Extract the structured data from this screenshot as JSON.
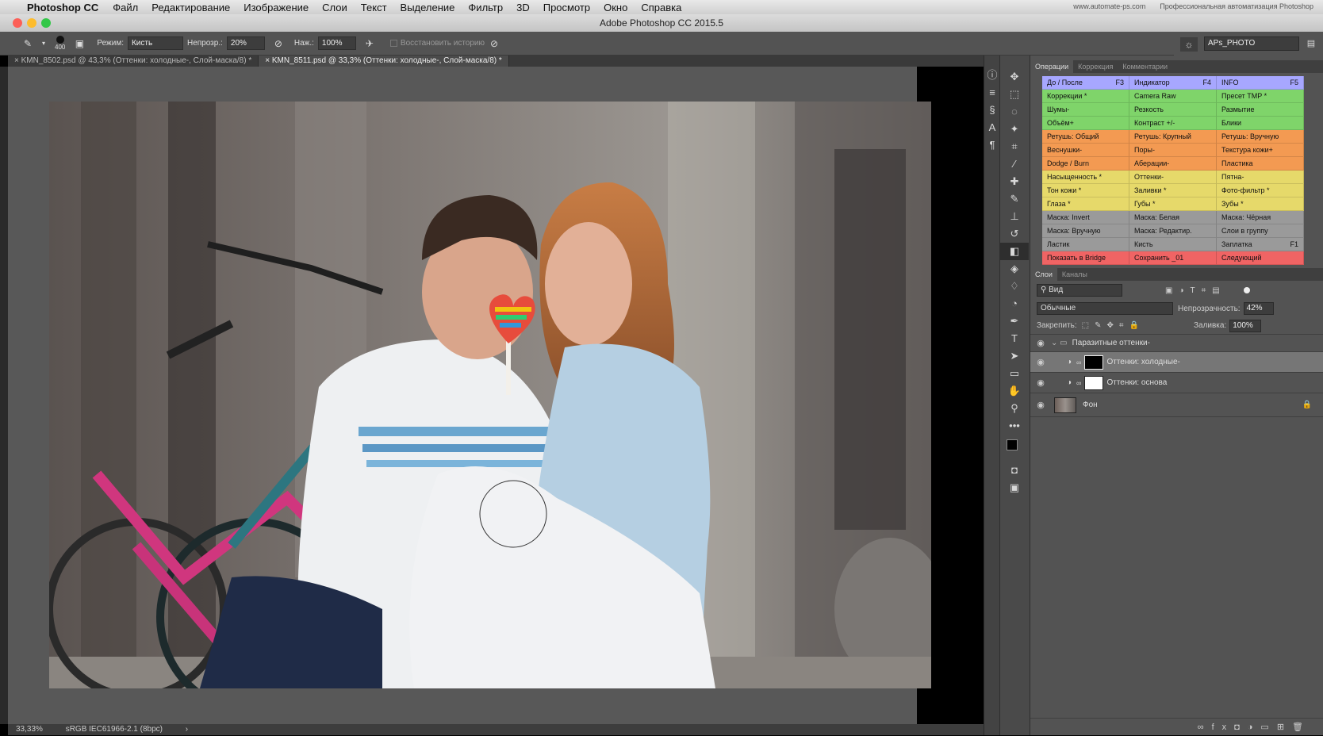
{
  "menubar": {
    "app": "Photoshop CC",
    "items": [
      "Файл",
      "Редактирование",
      "Изображение",
      "Слои",
      "Текст",
      "Выделение",
      "Фильтр",
      "3D",
      "Просмотр",
      "Окно",
      "Справка"
    ],
    "right_url": "www.automate-ps.com",
    "right_text": "Профессиональная автоматизация Photoshop"
  },
  "titlebar": {
    "title": "Adobe Photoshop CC 2015.5"
  },
  "options": {
    "brush_size": "400",
    "mode_label": "Режим:",
    "mode_value": "Кисть",
    "opacity_label": "Непрозр.:",
    "opacity_value": "20%",
    "flow_label": "Наж.:",
    "flow_value": "100%",
    "history_label": "Восстановить историю"
  },
  "workspace": {
    "name": "APs_PHOTO"
  },
  "doc_tabs": [
    {
      "label": "KMN_8502.psd @ 43,3% (Оттенки: холодные-, Слой-маска/8) *"
    },
    {
      "label": "KMN_8511.psd @ 33,3% (Оттенки: холодные-, Слой-маска/8) *"
    }
  ],
  "status": {
    "zoom": "33,33%",
    "profile": "sRGB IEC61966-2.1 (8bpc)"
  },
  "actions_panel": {
    "tabs": [
      "Операции",
      "Коррекция",
      "Комментарии"
    ],
    "rows": [
      {
        "color": "#a7a7ff",
        "cells": [
          {
            "t": "До / После",
            "k": "F3"
          },
          {
            "t": "Индикатор",
            "k": "F4"
          },
          {
            "t": "INFO",
            "k": "F5"
          }
        ]
      },
      {
        "color": "#7fd46a",
        "cells": [
          {
            "t": "Коррекции *",
            "k": ""
          },
          {
            "t": "Camera Raw",
            "k": ""
          },
          {
            "t": "Пресет TMP *",
            "k": ""
          }
        ]
      },
      {
        "color": "#7fd46a",
        "cells": [
          {
            "t": "Шумы-",
            "k": ""
          },
          {
            "t": "Резкость",
            "k": ""
          },
          {
            "t": "Размытие",
            "k": ""
          }
        ]
      },
      {
        "color": "#7fd46a",
        "cells": [
          {
            "t": "Объём+",
            "k": ""
          },
          {
            "t": "Контраст +/-",
            "k": ""
          },
          {
            "t": "Блики",
            "k": ""
          }
        ]
      },
      {
        "color": "#f39a52",
        "cells": [
          {
            "t": "Ретушь: Общий",
            "k": ""
          },
          {
            "t": "Ретушь: Крупный",
            "k": ""
          },
          {
            "t": "Ретушь: Вручную",
            "k": ""
          }
        ]
      },
      {
        "color": "#f39a52",
        "cells": [
          {
            "t": "Веснушки-",
            "k": ""
          },
          {
            "t": "Поры-",
            "k": ""
          },
          {
            "t": "Текстура кожи+",
            "k": ""
          }
        ]
      },
      {
        "color": "#f39a52",
        "cells": [
          {
            "t": "Dodge / Burn",
            "k": ""
          },
          {
            "t": "Аберации-",
            "k": ""
          },
          {
            "t": "Пластика",
            "k": ""
          }
        ]
      },
      {
        "color": "#e6d96a",
        "cells": [
          {
            "t": "Насыщенность *",
            "k": ""
          },
          {
            "t": "Оттенки-",
            "k": ""
          },
          {
            "t": "Пятна-",
            "k": ""
          }
        ]
      },
      {
        "color": "#e6d96a",
        "cells": [
          {
            "t": "Тон кожи *",
            "k": ""
          },
          {
            "t": "Заливки *",
            "k": ""
          },
          {
            "t": "Фото-фильтр *",
            "k": ""
          }
        ]
      },
      {
        "color": "#e6d96a",
        "cells": [
          {
            "t": "Глаза *",
            "k": ""
          },
          {
            "t": "Губы *",
            "k": ""
          },
          {
            "t": "Зубы *",
            "k": ""
          }
        ]
      },
      {
        "color": "#9a9a9a",
        "cells": [
          {
            "t": "Маска: Invert",
            "k": ""
          },
          {
            "t": "Маска: Белая",
            "k": ""
          },
          {
            "t": "Маска: Чёрная",
            "k": ""
          }
        ]
      },
      {
        "color": "#9a9a9a",
        "cells": [
          {
            "t": "Маска: Вручную",
            "k": ""
          },
          {
            "t": "Маска: Редактир.",
            "k": ""
          },
          {
            "t": "Слои в группу",
            "k": ""
          }
        ]
      },
      {
        "color": "#9a9a9a",
        "cells": [
          {
            "t": "Ластик",
            "k": ""
          },
          {
            "t": "Кисть",
            "k": ""
          },
          {
            "t": "Заплатка",
            "k": "F1"
          }
        ]
      },
      {
        "color": "#f06464",
        "cells": [
          {
            "t": "Показать в Bridge",
            "k": ""
          },
          {
            "t": "Сохранить _01",
            "k": ""
          },
          {
            "t": "Следующий",
            "k": ""
          }
        ]
      }
    ]
  },
  "layers_panel": {
    "tabs": [
      "Слои",
      "Каналы"
    ],
    "filter": "Вид",
    "blend": "Обычные",
    "opacity_label": "Непрозрачность:",
    "opacity_value": "42%",
    "lock_label": "Закрепить:",
    "fill_label": "Заливка:",
    "fill_value": "100%",
    "layers": [
      {
        "name": "Паразитные оттенки-",
        "type": "group"
      },
      {
        "name": "Оттенки: холодные-",
        "type": "adjustment",
        "selected": true,
        "mask": "black"
      },
      {
        "name": "Оттенки: основа",
        "type": "adjustment",
        "mask": "white"
      },
      {
        "name": "Фон",
        "type": "background",
        "locked": true
      }
    ]
  },
  "tools": [
    "move-tool-icon",
    "marquee-tool-icon",
    "lasso-tool-icon",
    "magic-wand-icon",
    "crop-tool-icon",
    "eyedropper-icon",
    "healing-brush-icon",
    "brush-tool-icon",
    "clone-stamp-icon",
    "history-brush-icon",
    "eraser-tool-icon",
    "paint-bucket-icon",
    "blur-tool-icon",
    "dodge-tool-icon",
    "pen-tool-icon",
    "type-tool-icon",
    "path-selection-icon",
    "rectangle-tool-icon",
    "hand-tool-icon",
    "zoom-tool-icon"
  ]
}
